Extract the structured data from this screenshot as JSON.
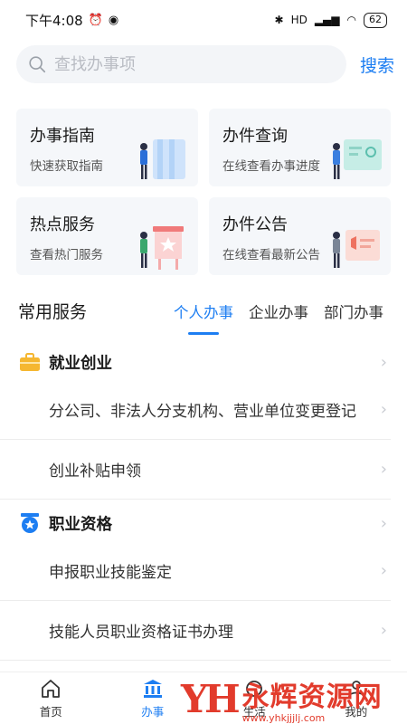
{
  "status_bar": {
    "time": "下午4:08",
    "battery": "62",
    "hd_label": "HD"
  },
  "search": {
    "placeholder": "查找办事项",
    "button_label": "搜索"
  },
  "cards": [
    {
      "title": "办事指南",
      "subtitle": "快速获取指南",
      "icon": "guide-illustration"
    },
    {
      "title": "办件查询",
      "subtitle": "在线查看办事进度",
      "icon": "query-illustration"
    },
    {
      "title": "热点服务",
      "subtitle": "查看热门服务",
      "icon": "hot-service-illustration"
    },
    {
      "title": "办件公告",
      "subtitle": "在线查看最新公告",
      "icon": "announcement-illustration"
    }
  ],
  "common_services": {
    "title": "常用服务",
    "tabs": [
      {
        "label": "个人办事",
        "active": true
      },
      {
        "label": "企业办事",
        "active": false
      },
      {
        "label": "部门办事",
        "active": false
      }
    ]
  },
  "sections": [
    {
      "name": "就业创业",
      "icon": "briefcase-icon",
      "items": [
        "分公司、非法人分支机构、营业单位变更登记",
        "创业补贴申领"
      ]
    },
    {
      "name": "职业资格",
      "icon": "medal-icon",
      "items": [
        "申报职业技能鉴定",
        "技能人员职业资格证书办理"
      ]
    }
  ],
  "bottom_nav": [
    {
      "label": "首页",
      "icon": "home-icon",
      "active": false
    },
    {
      "label": "办事",
      "icon": "government-building-icon",
      "active": true
    },
    {
      "label": "生活",
      "icon": "life-icon",
      "active": false
    },
    {
      "label": "我的",
      "icon": "user-icon",
      "active": false
    }
  ],
  "watermark": {
    "logo": "YH",
    "name": "永辉资源网",
    "url": "www.yhkjjjlj.com"
  },
  "colors": {
    "accent": "#1d7ef2",
    "card_bg": "#f5f7fa",
    "briefcase": "#f5b731",
    "medal": "#1d7ef2",
    "watermark": "#e23b2c"
  }
}
